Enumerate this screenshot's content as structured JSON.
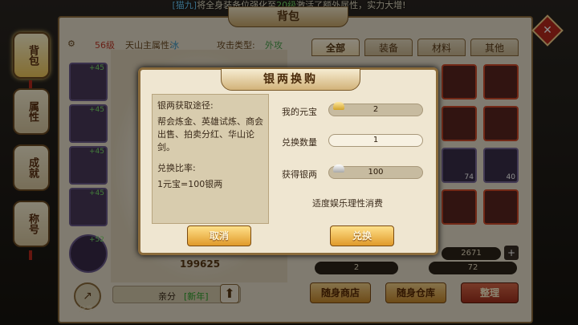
{
  "ticker": {
    "tag": "[猫九]",
    "pre": "将全身装备位强化至",
    "level": "20级",
    "post": "激活了额外属性，实力大增!"
  },
  "panel": {
    "title": "背包"
  },
  "sidebar": {
    "items": [
      {
        "label": "背包"
      },
      {
        "label": "属性"
      },
      {
        "label": "成就"
      },
      {
        "label": "称号"
      }
    ]
  },
  "player": {
    "level": "56级",
    "sect_label": "天山主属性:",
    "sect_value": "冰",
    "attack_label": "攻击类型:",
    "attack_value": "外攻",
    "power": "199625"
  },
  "equip_slots": [
    {
      "plus": "+45"
    },
    {
      "plus": "+45"
    },
    {
      "plus": "+45"
    },
    {
      "plus": "+45"
    },
    {
      "plus": "+52"
    }
  ],
  "tabs": [
    {
      "label": "全部"
    },
    {
      "label": "装备"
    },
    {
      "label": "材料"
    },
    {
      "label": "其他"
    }
  ],
  "cells": [
    {
      "num": ""
    },
    {
      "num": ""
    },
    {
      "num": ""
    },
    {
      "num": ""
    },
    {
      "num": "74"
    },
    {
      "num": "40"
    },
    {
      "num": ""
    },
    {
      "num": ""
    }
  ],
  "footer": {
    "share_label": "分享",
    "affinity_label": "亲分",
    "affinity_value": "[新年]"
  },
  "bottom": {
    "gold_value": "2",
    "silver_value": "2671",
    "jade_value": "72",
    "shop_label": "随身商店",
    "warehouse_label": "随身仓库",
    "sort_label": "整理",
    "plus": "+"
  },
  "dialog": {
    "title": "银两换购",
    "ways_title": "银两获取途径:",
    "ways_text": "帮会炼金、英雄试炼、商会出售、拍卖分红、华山论剑。",
    "ratio_title": "兑换比率:",
    "ratio_text": "1元宝=100银两",
    "my_yuanbao_label": "我的元宝",
    "my_yuanbao_value": "2",
    "qty_label": "兑换数量",
    "qty_value": "1",
    "silver_label": "获得银两",
    "silver_value": "100",
    "note": "适度娱乐理性消费",
    "cancel": "取消",
    "confirm": "兑换"
  },
  "colors": {
    "accent": "#e09a2a",
    "frame": "#8a6b3b",
    "text": "#3a2a1a"
  },
  "icons": {
    "close": "close-icon",
    "gold_ingot": "gold-ingot-icon",
    "silver_ingot": "silver-ingot-icon"
  }
}
